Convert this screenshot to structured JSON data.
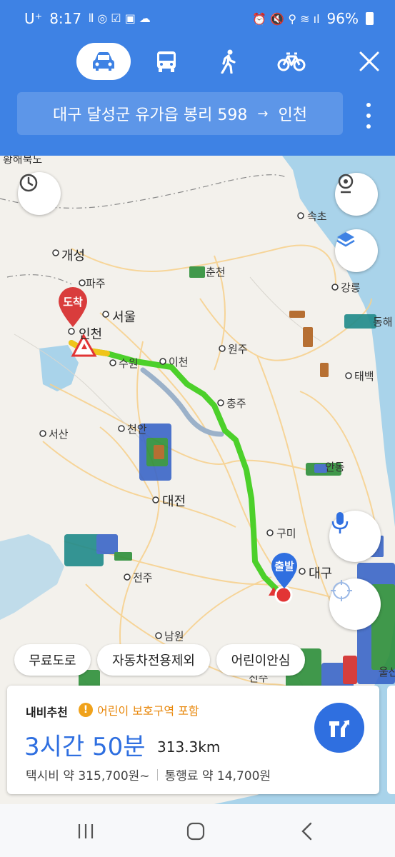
{
  "status_bar": {
    "carrier": "U⁺",
    "time": "8:17",
    "battery": "96%"
  },
  "modes": [
    {
      "name": "car",
      "icon": "car-icon",
      "active": true
    },
    {
      "name": "bus",
      "icon": "bus-icon",
      "active": false
    },
    {
      "name": "walk",
      "icon": "walk-icon",
      "active": false
    },
    {
      "name": "bike",
      "icon": "bike-icon",
      "active": false
    }
  ],
  "route": {
    "origin": "대구 달성군 유가읍 봉리 598",
    "arrow": "→",
    "destination": "인천"
  },
  "map": {
    "labels": {
      "hwanghae": "황해북도",
      "gaeseong": "개성",
      "paju": "파주",
      "chuncheon": "춘천",
      "seoul": "서울",
      "incheon": "인천",
      "suwon": "수원",
      "icheon": "이천",
      "wonju": "원주",
      "sokcho": "속초",
      "gangneung": "강릉",
      "donghae": "동해",
      "taebaek": "태백",
      "chungju": "충주",
      "seosan": "서산",
      "cheonan": "천안",
      "daejeon": "대전",
      "andong": "안동",
      "gumi": "구미",
      "daegu": "대구",
      "jeonju": "전주",
      "namwon": "남원",
      "jinju": "진주",
      "ulsan": "울산"
    },
    "pins": {
      "arrival": "도착",
      "departure": "출발"
    }
  },
  "filters": [
    "무료도로",
    "자동차전용제외",
    "어린이안심"
  ],
  "result": {
    "recommend": "내비추천",
    "warning": "어린이 보호구역 포함",
    "duration": "3시간 50분",
    "distance": "313.3km",
    "taxi_fare": "택시비 약 315,700원~",
    "toll": "통행료 약 14,700원"
  },
  "colors": {
    "primary": "#3e82e4",
    "route_main": "#4cd02a",
    "route_alt": "#9bb1c9",
    "route_toll": "#f0c419",
    "warning": "#e8870a",
    "duration": "#2f6fe0"
  }
}
